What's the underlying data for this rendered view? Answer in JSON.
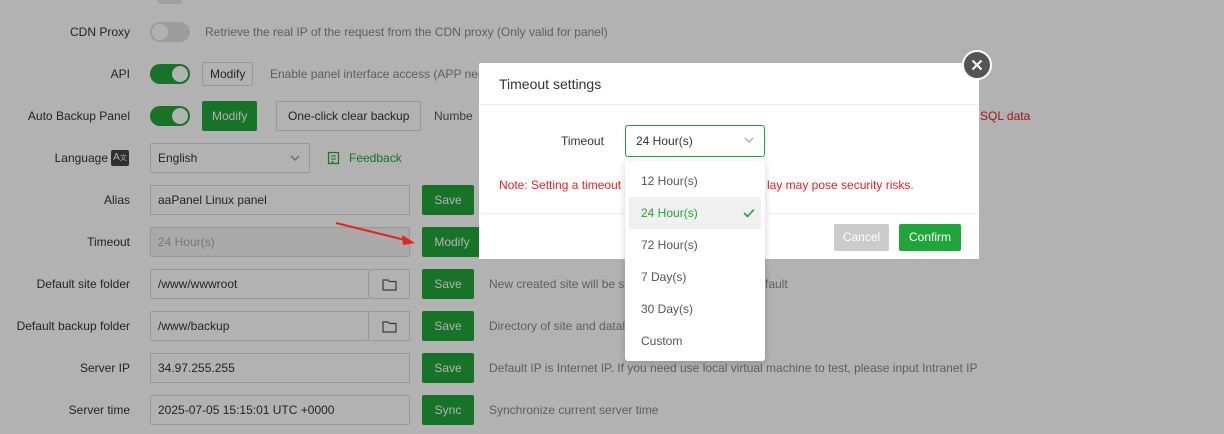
{
  "settings": {
    "cdn_proxy": {
      "label": "CDN Proxy",
      "hint": "Retrieve the real IP of the request from the CDN proxy  (Only valid for panel)"
    },
    "api": {
      "label": "API",
      "modify": "Modify",
      "hint": "Enable panel interface access (APP need"
    },
    "auto_backup": {
      "label": "Auto Backup Panel",
      "modify": "Modify",
      "clear": "One-click clear backup",
      "hint": "Numbe",
      "hint_right": "SQL data"
    },
    "language": {
      "label": "Language",
      "value": "English",
      "feedback": "Feedback"
    },
    "alias": {
      "label": "Alias",
      "value": "aaPanel Linux panel",
      "save": "Save"
    },
    "timeout": {
      "label": "Timeout",
      "value": "24 Hour(s)",
      "modify": "Modify"
    },
    "site_folder": {
      "label": "Default site folder",
      "value": "/www/wwwroot",
      "save": "Save",
      "hint": "New created site will be sa",
      "hint_right": "fault"
    },
    "backup_folder": {
      "label": "Default backup folder",
      "value": "/www/backup",
      "save": "Save",
      "hint": "Directory of site and datal"
    },
    "server_ip": {
      "label": "Server IP",
      "value": "34.97.255.255",
      "save": "Save",
      "hint": "Default IP is Internet IP. If you need use local virtual machine to test, please input Intranet IP"
    },
    "server_time": {
      "label": "Server time",
      "value": "2025-07-05 15:15:01 UTC +0000",
      "sync": "Sync",
      "hint": "Synchronize current server time"
    }
  },
  "modal": {
    "title": "Timeout settings",
    "field_label": "Timeout",
    "selected": "24 Hour(s)",
    "note_left": "Note: Setting a timeout",
    "note_right": "lay may pose security risks.",
    "cancel": "Cancel",
    "confirm": "Confirm",
    "options": [
      "12 Hour(s)",
      "24 Hour(s)",
      "72 Hour(s)",
      "7 Day(s)",
      "30 Day(s)",
      "Custom"
    ]
  },
  "colors": {
    "accent": "#20a53a",
    "danger": "#e02020",
    "arrow": "#e8231c"
  },
  "icons": {
    "close": "close-icon",
    "chevron": "chevron-down-icon",
    "check": "check-icon",
    "folder": "folder-icon",
    "translate": "translate-icon",
    "feedback": "edit-icon"
  }
}
